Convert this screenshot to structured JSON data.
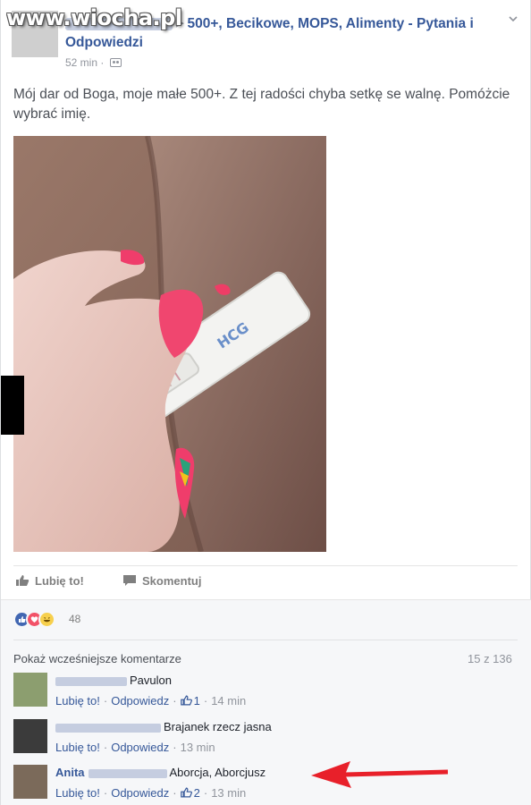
{
  "watermark": "www.wiocha.pl",
  "post": {
    "group_name": "500+, Becikowe, MOPS, Alimenty - Pytania i Odpowiedzi",
    "time": "52 min",
    "text": "Mój dar od Boga, moje małe 500+. Z tej radości chyba setkę se walnę. Pomóżcie wybrać imię.",
    "photo_label": "HCG"
  },
  "actions": {
    "like": "Lubię to!",
    "comment": "Skomentuj"
  },
  "reactions": {
    "count": "48"
  },
  "comments_header": {
    "more": "Pokaż wcześniejsze komentarze",
    "count": "15 z 136"
  },
  "comments": [
    {
      "author": "",
      "text": "Pavulon",
      "like": "Lubię to!",
      "reply": "Odpowiedz",
      "likes": "1",
      "time": "14 min"
    },
    {
      "author": "",
      "text": "Brajanek rzecz jasna",
      "like": "Lubię to!",
      "reply": "Odpowiedz",
      "likes": "",
      "time": "13 min"
    },
    {
      "author": "Anita",
      "text": "Aborcja, Aborcjusz",
      "like": "Lubię to!",
      "reply": "Odpowiedz",
      "likes": "2",
      "time": "13 min"
    }
  ],
  "colors": {
    "link": "#365899",
    "arrow": "#e8202a"
  }
}
